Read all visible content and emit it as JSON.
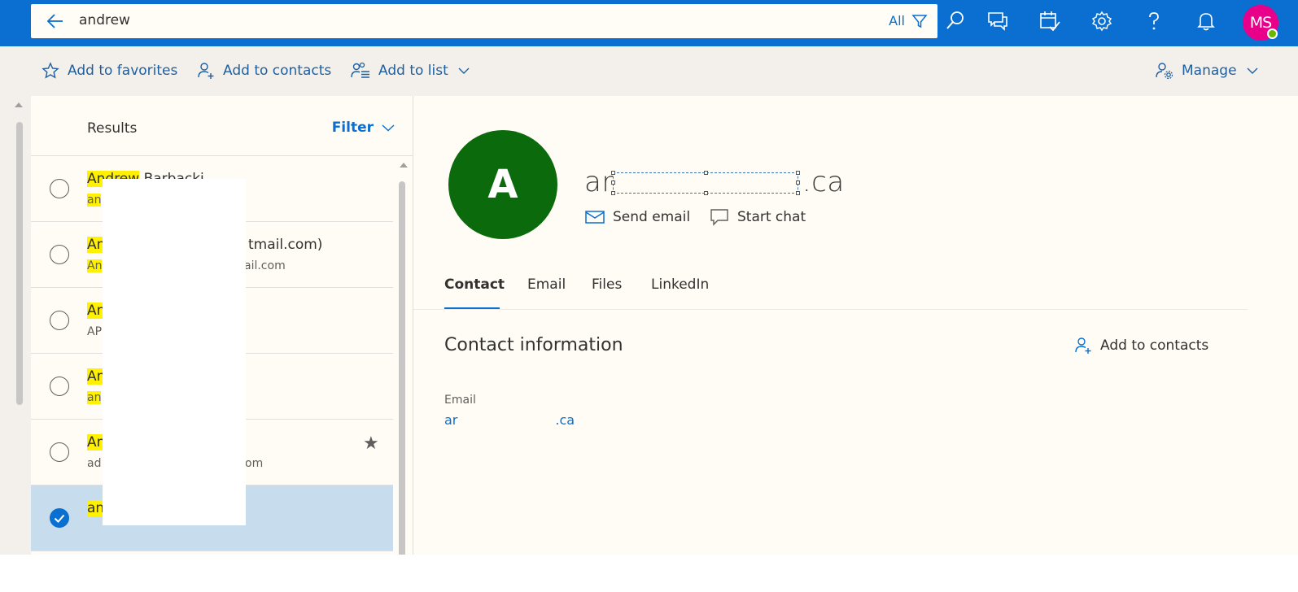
{
  "topbar": {
    "search_query": "andrew",
    "search_scope": "All",
    "avatar_initials": "MS",
    "colors": {
      "bar": "#0a6fd0",
      "avatar": "#e8008a",
      "presence": "#6bb700"
    },
    "icons": [
      "back-arrow-icon",
      "filter-icon",
      "search-icon",
      "chat-icon",
      "calendar-check-icon",
      "gear-icon",
      "help-icon",
      "bell-icon"
    ]
  },
  "commands": {
    "favorites": "Add to favorites",
    "contacts": "Add to contacts",
    "list": "Add to list",
    "manage": "Manage"
  },
  "list": {
    "results_label": "Results",
    "filter_label": "Filter",
    "rows": [
      {
        "name_hl": "Andrew",
        "name_rest": " Barbacki",
        "sub_hl": "an",
        "sub_rest": ""
      },
      {
        "name_hl": "An",
        "name_rest": "tmail.com)",
        "sub_hl": "An",
        "sub_rest": "ail.com"
      },
      {
        "name_hl": "An",
        "name_rest": "",
        "sub_hl": "",
        "sub_rest": "AP"
      },
      {
        "name_hl": "An",
        "name_rest": "",
        "sub_hl": "an",
        "sub_rest": ""
      },
      {
        "name_hl": "An",
        "name_rest": "",
        "sub_hl": "",
        "sub_rest": "ad",
        "sub_tail": "om",
        "starred": true
      },
      {
        "name_hl": "an",
        "name_rest": "",
        "selected": true
      }
    ]
  },
  "detail": {
    "avatar_letter": "A",
    "avatar_color": "#0b6a0b",
    "name_start": "ar",
    "name_end": ".ca",
    "send_email": "Send email",
    "start_chat": "Start chat",
    "tabs": [
      "Contact",
      "Email",
      "Files",
      "LinkedIn"
    ],
    "section_title": "Contact information",
    "add_to_contacts": "Add to contacts",
    "email_label": "Email",
    "email_start": "ar",
    "email_end": ".ca"
  }
}
